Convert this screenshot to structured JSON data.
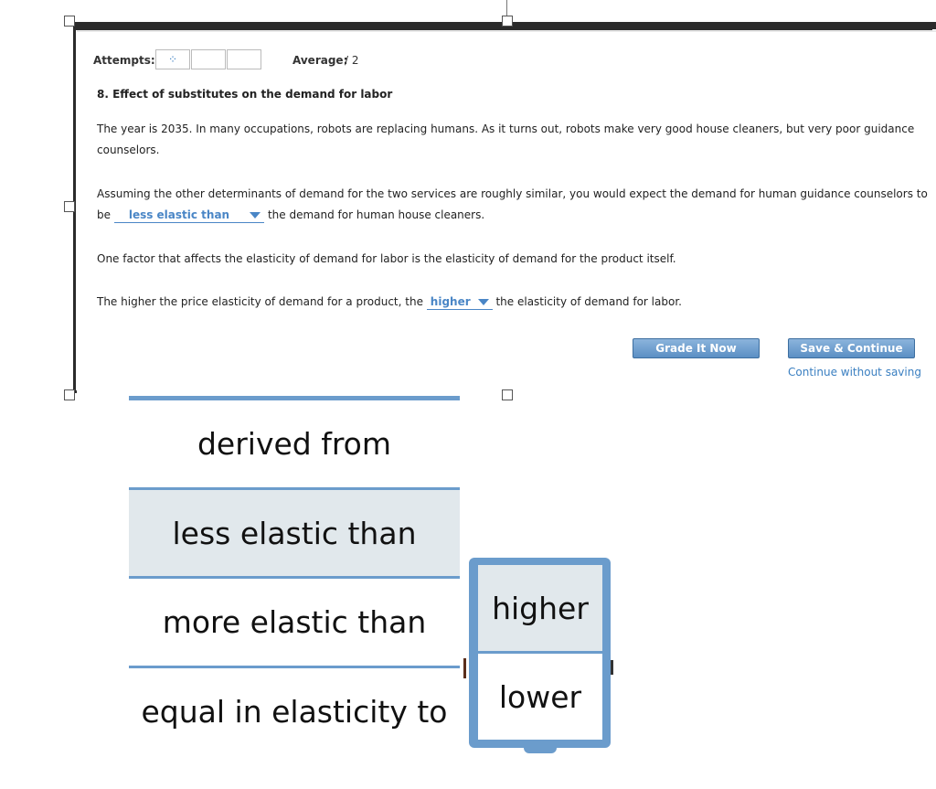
{
  "header": {
    "attempts_label": "Attempts:",
    "attempts_icon": "loading-dots-icon",
    "average_label": "Average:",
    "average_value": "/ 2"
  },
  "question": {
    "title": "8. Effect of substitutes on the demand for labor",
    "intro_line1": "The year is 2035. In many occupations, robots are replacing humans. As it turns out, robots make very good house cleaners, but very poor guidance",
    "intro_line2": "counselors.",
    "p2_line1": "Assuming the other determinants of demand for the two services are roughly similar, you would expect the demand for human guidance counselors to",
    "p2_prefix": "be",
    "p2_select_value": "less elastic than",
    "p2_suffix": "the demand for human house cleaners.",
    "p3": "One factor that affects the elasticity of demand for labor is the elasticity of demand for the product itself.",
    "p4_prefix": "The higher the price elasticity of demand for a product, the",
    "p4_select_value": "higher",
    "p4_suffix": "the elasticity of demand for labor."
  },
  "actions": {
    "grade_label": "Grade It Now",
    "save_label": "Save & Continue",
    "continue_link": "Continue without saving"
  },
  "dropdown_elasticity": {
    "options": [
      "derived from",
      "less elastic than",
      "more elastic than",
      "equal in elasticity to"
    ],
    "selected": "less elastic than"
  },
  "dropdown_direction": {
    "options": [
      "higher",
      "lower"
    ],
    "selected": "higher"
  },
  "colors": {
    "accent": "#4a86c6",
    "dropdown_border": "#6b9ccc",
    "selected_bg": "#e1e8ec"
  }
}
